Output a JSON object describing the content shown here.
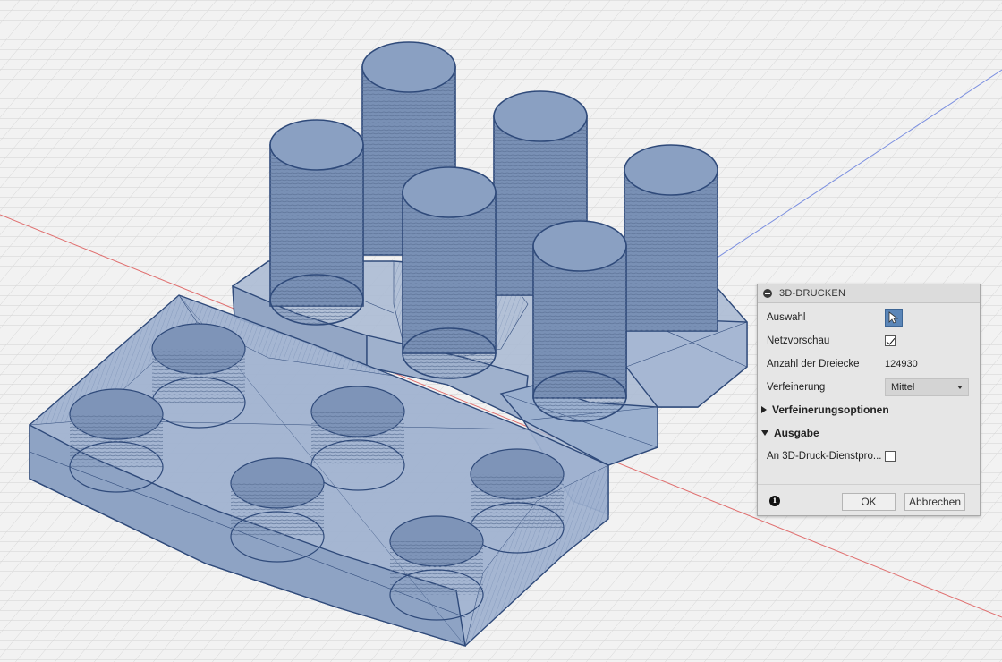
{
  "viewport": {
    "name": "3d-viewport",
    "colors": {
      "background": "#f2f2f2",
      "grid": "#d6d6d6",
      "x_axis": "#e07070",
      "y_axis": "#7b8fe0",
      "mesh_fill": "#7f97bb",
      "mesh_edge": "#2f4a7a"
    }
  },
  "panel": {
    "title": "3D-DRUCKEN",
    "fields": {
      "selection_label": "Auswahl",
      "mesh_preview_label": "Netzvorschau",
      "mesh_preview_checked": true,
      "triangle_count_label": "Anzahl der Dreiecke",
      "triangle_count_value": "124930",
      "refinement_label": "Verfeinerung",
      "refinement_value": "Mittel"
    },
    "sections": {
      "refinement_options": "Verfeinerungsoptionen",
      "output": "Ausgabe"
    },
    "output": {
      "send_to_service_label": "An 3D-Druck-Dienstpro...",
      "send_to_service_checked": false
    },
    "footer": {
      "ok_label": "OK",
      "cancel_label": "Abbrechen"
    },
    "icons": {
      "collapse": "minus-circle-icon",
      "select": "cursor-arrow-icon",
      "info": "info-icon"
    }
  }
}
